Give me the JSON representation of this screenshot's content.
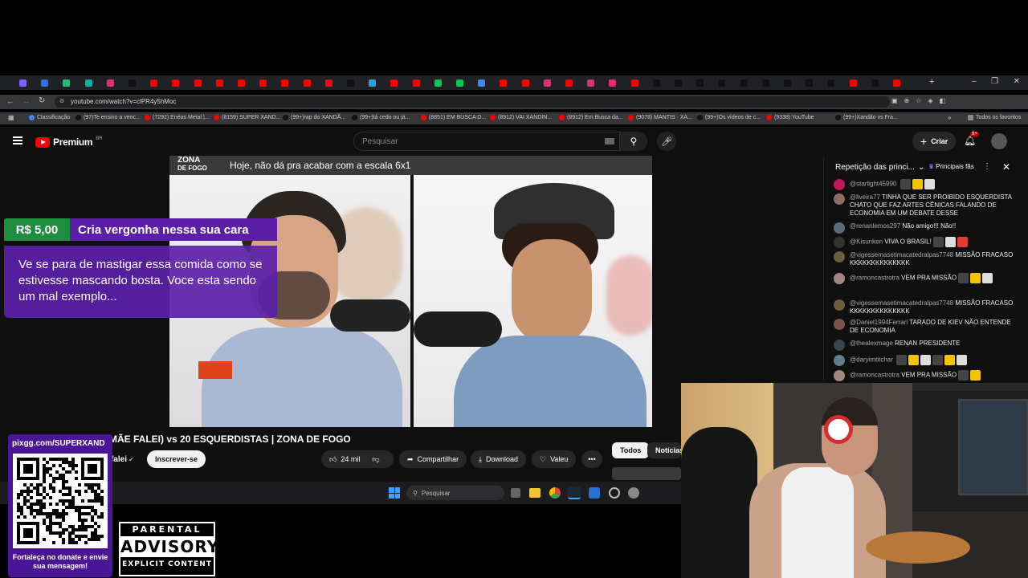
{
  "browser": {
    "url": "youtube.com/watch?v=clPR4y5hMoc",
    "tabs_count": 46,
    "bookmarks": [
      {
        "label": "Classificação",
        "color": "#4285f4"
      },
      {
        "label": "(97)Te ensino a venc...",
        "color": "#111"
      },
      {
        "label": "(7292) Enéas Metal |...",
        "color": "#ff0000"
      },
      {
        "label": "(8159) SUPER XAND...",
        "color": "#ff0000"
      },
      {
        "label": "(99+)rap do XANDÃ...",
        "color": "#111"
      },
      {
        "label": "(99+)tá cedo ou já...",
        "color": "#111"
      },
      {
        "label": "(8851) EM BUSCA D...",
        "color": "#ff0000"
      },
      {
        "label": "(8912) VAI XANDIN...",
        "color": "#ff0000"
      },
      {
        "label": "(8912) Em Busca da...",
        "color": "#ff0000"
      },
      {
        "label": "(9078) MANTIS · XA...",
        "color": "#ff0000"
      },
      {
        "label": "(99+)Os vídeos de c...",
        "color": "#111"
      },
      {
        "label": "(9338) YouTube",
        "color": "#ff0000"
      },
      {
        "label": "(99+)Xandão vs Fra...",
        "color": "#111"
      }
    ],
    "all_bookmarks": "Todos os favoritos"
  },
  "youtube": {
    "logo": "Premium",
    "region": "BR",
    "search_placeholder": "Pesquisar",
    "create_label": "Criar",
    "notif_count": "9+",
    "video_title": "MÃE FALEI) vs 20 ESQUERDISTAS | ZONA DE FOGO",
    "channel_partial": "falei",
    "subscribe_label": "Inscrever-se",
    "likes": "24 mil",
    "share_label": "Compartilhar",
    "download_label": "Download",
    "thanks_label": "Valeu",
    "chip_all": "Todos",
    "chip_news": "Notícias"
  },
  "video": {
    "brand_top": "ZONA",
    "brand_bottom": "DE FOGO",
    "caption": "Hoje, não dá pra acabar com a escala 6x1"
  },
  "donation": {
    "amount": "R$ 5,00",
    "title": "Cria vergonha nessa sua cara",
    "message": "Ve se para de mastigar essa comida como se estivesse mascando bosta. Voce esta sendo um mal exemplo..."
  },
  "chat": {
    "header": "Repetição das princi...",
    "badge": "Principais fãs",
    "messages": [
      {
        "user": "@starlight45990",
        "text": "",
        "emojis": [
          "#444",
          "#f5c400",
          "#ddd"
        ],
        "avatar": "#c2185b"
      },
      {
        "user": "@liveira77",
        "text": "TINHA QUE SER PROIBIDO ESQUERDISTA CHATO QUE FAZ ARTES CÊNICAS FALANDO DE ECONOMIA EM UM DEBATE DESSE",
        "emojis": [],
        "avatar": "#8d6e63"
      },
      {
        "user": "@renanlemos297",
        "text": "Não amigo!!! Não!!",
        "emojis": [],
        "avatar": "#546e7a"
      },
      {
        "user": "@Kisunken",
        "text": "VIVA O BRASIL!",
        "emojis": [
          "#444",
          "#ddd",
          "#e53935"
        ],
        "avatar": "#333"
      },
      {
        "user": "@vigessemasetimacatedralpas7748",
        "text": "MISSÃO FRACASO KKKKKKKKKKKKKK",
        "emojis": [],
        "avatar": "#6d5d3d"
      },
      {
        "user": "@ramoncastrotra",
        "text": "VEM PRA MISSÃO",
        "emojis": [
          "#444",
          "#f5c400",
          "#ddd"
        ],
        "avatar": "#a1887f"
      },
      {
        "user": "@vigessemasetimacatedralpas7748",
        "text": "MISSÃO FRACASO KKKKKKKKKKKKKK",
        "emojis": [],
        "avatar": "#6d5d3d"
      },
      {
        "user": "@Daniel1994Ferrari",
        "text": "TARADO DE KIEV NÃO ENTENDE DE ECONOMIA",
        "emojis": [],
        "avatar": "#795548"
      },
      {
        "user": "@thealexmage",
        "text": "RENAN PRESIDENTE",
        "emojis": [],
        "avatar": "#37474f"
      },
      {
        "user": "@daryimtitchar",
        "text": "",
        "emojis": [
          "#444",
          "#f5c400",
          "#ddd",
          "#444",
          "#f5c400",
          "#ddd"
        ],
        "avatar": "#607d8b"
      },
      {
        "user": "@ramoncastrotra",
        "text": "VEM PRA MISSÃO",
        "emojis": [
          "#444",
          "#f5c400"
        ],
        "avatar": "#a1887f"
      }
    ]
  },
  "taskbar": {
    "search_placeholder": "Pesquisar"
  },
  "stream": {
    "qr_url": "pixgg.com/SUPERXAND",
    "qr_caption": "Fortaleça no donate e envie sua mensagem!",
    "advisory_top": "PARENTAL",
    "advisory_mid": "ADVISORY",
    "advisory_bottom": "EXPLICIT CONTENT"
  },
  "colors": {
    "youtube_red": "#ff0000",
    "donation_green": "#1e8e3e",
    "donation_purple": "#5b1fa8"
  }
}
